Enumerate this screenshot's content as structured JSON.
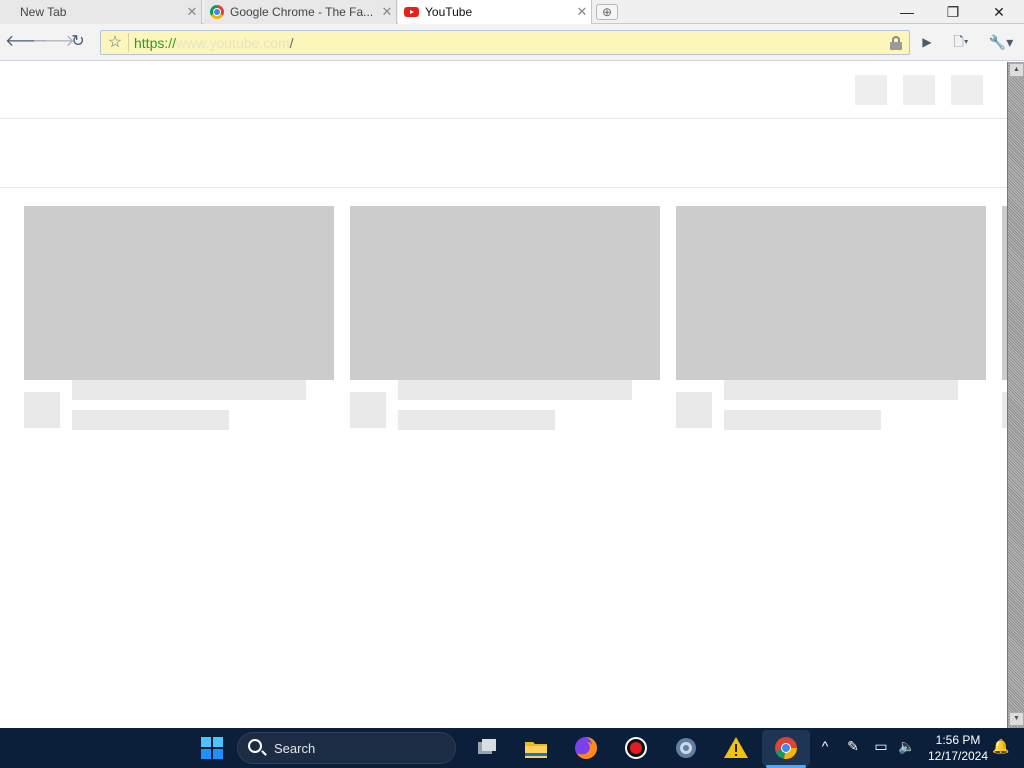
{
  "browser": {
    "tabs": [
      {
        "label": "New Tab",
        "icon": "none"
      },
      {
        "label": "Google Chrome - The Fa...",
        "icon": "chrome-icon"
      },
      {
        "label": "YouTube",
        "icon": "youtube-icon"
      }
    ],
    "active_tab": 2,
    "omnibox": {
      "scheme": "https://",
      "host": "www.youtube.com",
      "path": "/"
    }
  },
  "page": {
    "loading_placeholder_cards": 3
  },
  "taskbar": {
    "search_label": "Search",
    "time": "1:56 PM",
    "date": "12/17/2024"
  },
  "colors": {
    "taskbar_bg": "#0c1f3a",
    "omnibox_bg": "#fdf6bb",
    "placeholder_thumb": "#cccccc",
    "placeholder_text": "#e9e9e9",
    "https_green": "#2b9a2b"
  }
}
